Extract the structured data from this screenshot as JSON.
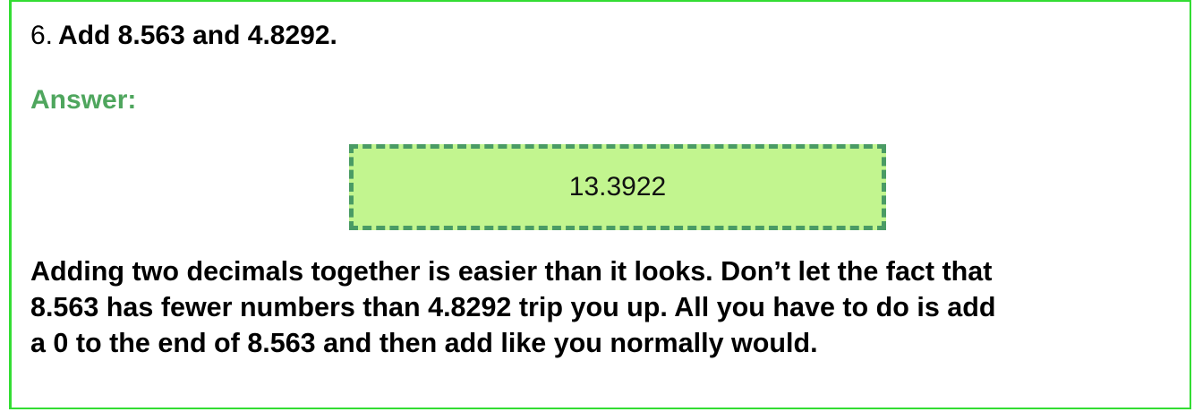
{
  "question": {
    "number": "6.",
    "text": "Add 8.563 and 4.8292."
  },
  "answer": {
    "label": "Answer:",
    "value": "13.3922"
  },
  "explanation": {
    "lines": [
      "Adding two decimals together is easier than it looks. Don’t let the fact that",
      "8.563 has fewer numbers than 4.8292 trip you up. All you have to do is add",
      "a 0 to the end of 8.563 and then add like you normally would."
    ]
  },
  "colors": {
    "frame_border": "#33dd33",
    "answer_label": "#4fa65e",
    "answer_box_fill": "#c2f58f",
    "answer_box_border": "#4a9b65"
  }
}
